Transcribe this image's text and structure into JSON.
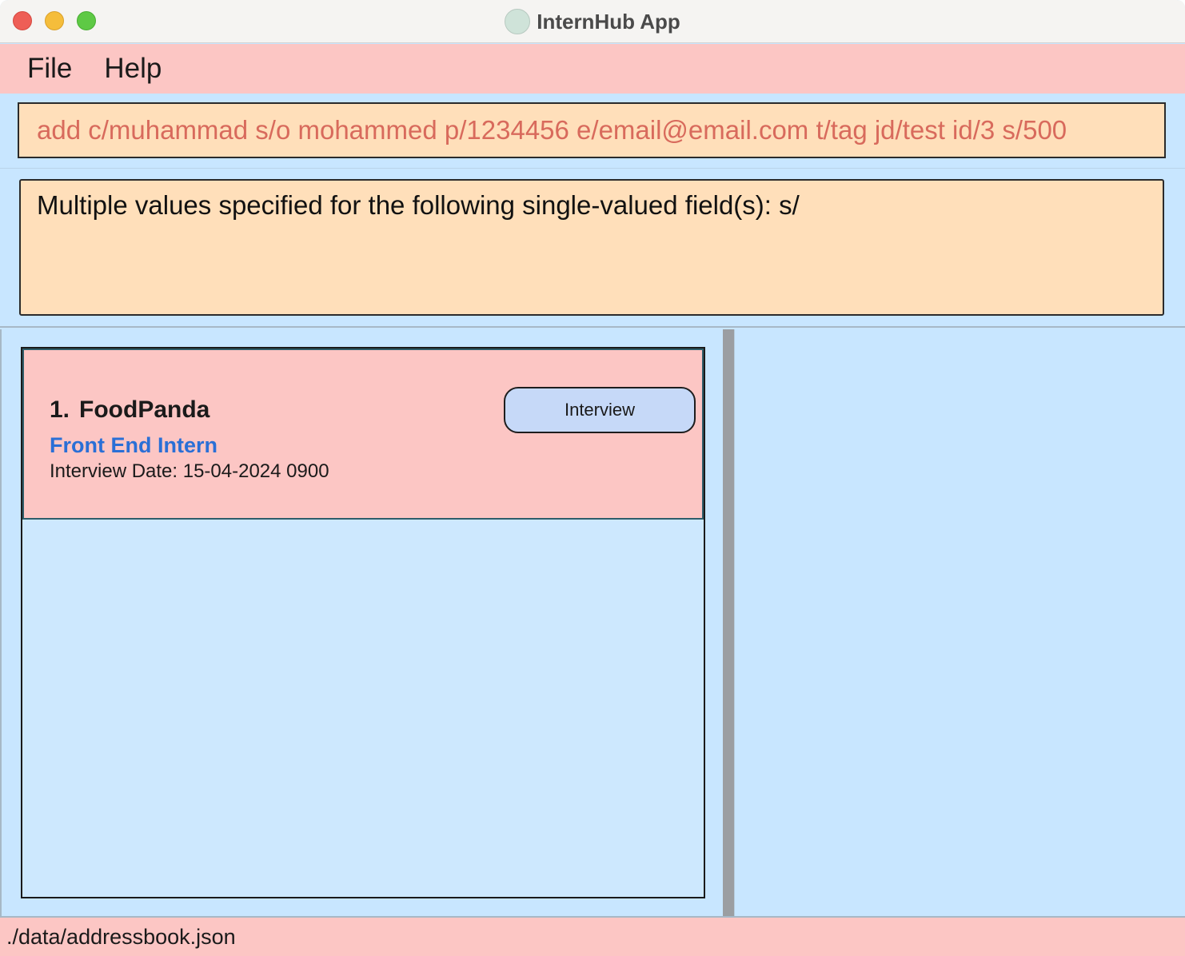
{
  "window": {
    "title": "InternHub App"
  },
  "menu": {
    "items": [
      "File",
      "Help"
    ]
  },
  "command": {
    "value": "add c/muhammad s/o mohammed p/1234456 e/email@email.com t/tag jd/test id/3 s/500"
  },
  "result": {
    "message": "Multiple values specified for the following single-valued field(s): s/"
  },
  "list": {
    "cards": [
      {
        "index": "1.",
        "company": "FoodPanda",
        "role": "Front End Intern",
        "interview_date": "Interview Date: 15-04-2024 0900",
        "status": "Interview"
      }
    ]
  },
  "statusbar": {
    "path": "./data/addressbook.json"
  },
  "colors": {
    "menu_bg": "#fcc6c4",
    "panel_bg": "#c8e6ff",
    "box_bg": "#ffdfba",
    "command_text": "#d86a5c",
    "role_text": "#2a6fd6",
    "chip_bg": "#c6d9f8"
  }
}
